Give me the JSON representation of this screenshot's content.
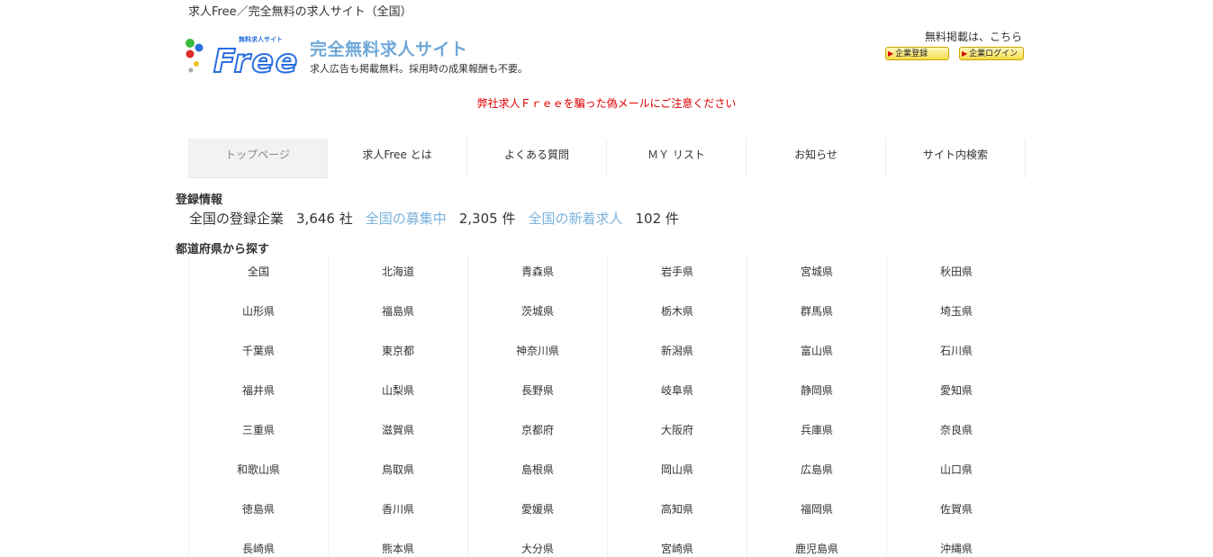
{
  "header": {
    "tagline": "求人Free／完全無料の求人サイト（全国）",
    "brand_title": "完全無料求人サイト",
    "brand_sub": "求人広告も掲載無料。採用時の成果報酬も不要。",
    "logo_small_text": "無料求人サイト",
    "logo_text": "Free",
    "listing_note": "無料掲載は、こちら",
    "register_btn": "企業登録",
    "login_btn": "企業ログイン"
  },
  "warning": "弊社求人Ｆｒｅｅを騙った偽メールにご注意ください",
  "nav": [
    {
      "label": "トップページ"
    },
    {
      "label": "求人Free とは"
    },
    {
      "label": "よくある質問"
    },
    {
      "label": "ＭＹ リスト"
    },
    {
      "label": "お知らせ"
    },
    {
      "label": "サイト内検索"
    }
  ],
  "registration": {
    "title": "登録情報",
    "companies_label": "全国の登録企業",
    "companies_value": "3,646 社",
    "jobs_label": "全国の募集中",
    "jobs_value": "2,305 件",
    "new_label": "全国の新着求人",
    "new_value": "102 件"
  },
  "prefectures": {
    "title": "都道府県から探す",
    "items": [
      "全国",
      "北海道",
      "青森県",
      "岩手県",
      "宮城県",
      "秋田県",
      "山形県",
      "福島県",
      "茨城県",
      "栃木県",
      "群馬県",
      "埼玉県",
      "千葉県",
      "東京都",
      "神奈川県",
      "新潟県",
      "富山県",
      "石川県",
      "福井県",
      "山梨県",
      "長野県",
      "岐阜県",
      "静岡県",
      "愛知県",
      "三重県",
      "滋賀県",
      "京都府",
      "大阪府",
      "兵庫県",
      "奈良県",
      "和歌山県",
      "鳥取県",
      "島根県",
      "岡山県",
      "広島県",
      "山口県",
      "徳島県",
      "香川県",
      "愛媛県",
      "高知県",
      "福岡県",
      "佐賀県",
      "長崎県",
      "熊本県",
      "大分県",
      "宮崎県",
      "鹿児島県",
      "沖縄県"
    ]
  },
  "colors": {
    "brand_blue": "#6fa8d8",
    "link_blue": "#7ab2dc",
    "warning_red": "#e00000",
    "logo_blue": "#2a6fe0"
  }
}
